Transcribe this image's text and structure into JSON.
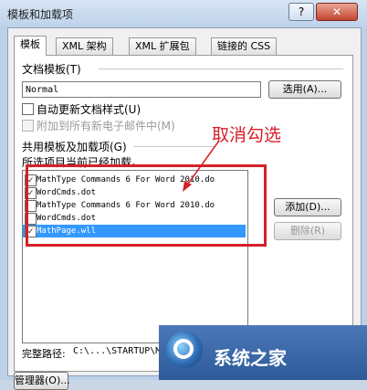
{
  "window": {
    "title": "模板和加载项",
    "help_label": "?",
    "close_label": "✕"
  },
  "tabs": [
    {
      "label": "模板"
    },
    {
      "label": "XML 架构"
    },
    {
      "label": "XML 扩展包"
    },
    {
      "label": "链接的 CSS"
    }
  ],
  "document_template": {
    "heading": "文档模板(T)",
    "value": "Normal",
    "select_label": "选用(A)..."
  },
  "options": {
    "auto_update": "自动更新文档样式(U)",
    "attach_to_email": "附加到所有新电子邮件中(M)"
  },
  "global": {
    "heading": "共用模板及加载项(G)",
    "subtitle": "所选项目当前已经加载。",
    "add_label": "添加(D)...",
    "remove_label": "删除(R)",
    "items": [
      {
        "label": "MathType Commands 6 For Word 2010.do",
        "checked": true
      },
      {
        "label": "WordCmds.dot",
        "checked": true
      },
      {
        "label": "MathType Commands 6 For Word 2010.do",
        "checked": false
      },
      {
        "label": "WordCmds.dot",
        "checked": false
      },
      {
        "label": "MathPage.wll",
        "checked": true
      }
    ]
  },
  "full_path": {
    "label": "完整路径:",
    "value": "C:\\...\\STARTUP\\MathPage.wll"
  },
  "organizer_label": "管理器(O)...",
  "annotation": "取消勾选",
  "logo_text": "系统之家",
  "colors": {
    "annotation": "#d6202a",
    "selection": "#3399ff"
  }
}
